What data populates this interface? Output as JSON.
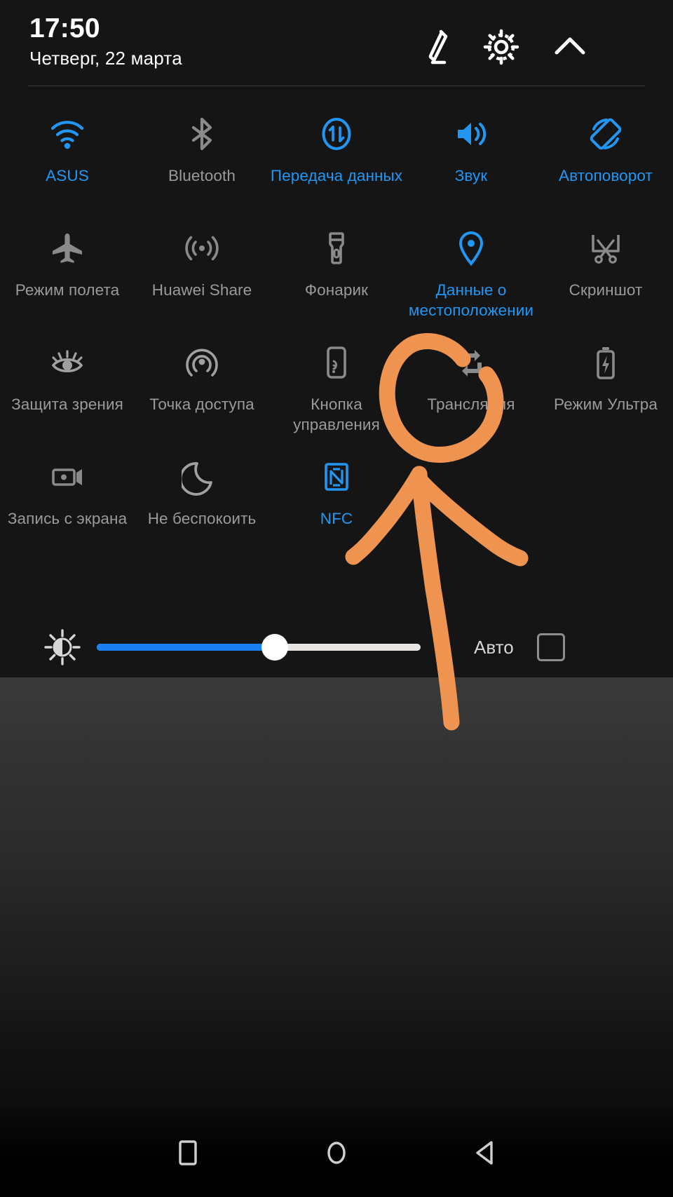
{
  "header": {
    "time": "17:50",
    "date": "Четверг, 22 марта",
    "edit_icon": "pencil-edit-icon",
    "settings_icon": "gear-icon",
    "collapse_icon": "chevron-up-icon"
  },
  "colors": {
    "active": "#2196f3",
    "inactive": "#9a9a9a",
    "shade_bg": "#151515",
    "annotation": "#ef9350",
    "slider_fill": "#1a7ff0",
    "slider_track": "#e8e6e3"
  },
  "tiles": [
    {
      "label": "ASUS",
      "icon": "wifi-icon",
      "state": "on"
    },
    {
      "label": "Bluetooth",
      "icon": "bluetooth-icon",
      "state": "off"
    },
    {
      "label": "Передача данных",
      "icon": "mobile-data-icon",
      "state": "on"
    },
    {
      "label": "Звук",
      "icon": "volume-icon",
      "state": "on"
    },
    {
      "label": "Автоповорот",
      "icon": "auto-rotate-icon",
      "state": "on"
    },
    {
      "label": "Режим полета",
      "icon": "airplane-icon",
      "state": "off"
    },
    {
      "label": "Huawei Share",
      "icon": "huawei-share-icon",
      "state": "off"
    },
    {
      "label": "Фонарик",
      "icon": "flashlight-icon",
      "state": "off"
    },
    {
      "label": "Данные о местоположении",
      "icon": "location-pin-icon",
      "state": "on"
    },
    {
      "label": "Скриншот",
      "icon": "screenshot-icon",
      "state": "off"
    },
    {
      "label": "Защита зрения",
      "icon": "eye-comfort-icon",
      "state": "off"
    },
    {
      "label": "Точка доступа",
      "icon": "hotspot-icon",
      "state": "off"
    },
    {
      "label": "Кнопка управления",
      "icon": "nav-dock-icon",
      "state": "off"
    },
    {
      "label": "Трансляция",
      "icon": "cast-icon",
      "state": "off"
    },
    {
      "label": "Режим Ультра",
      "icon": "battery-ultra-icon",
      "state": "off"
    },
    {
      "label": "Запись с экрана",
      "icon": "screen-record-icon",
      "state": "off"
    },
    {
      "label": "Не беспокоить",
      "icon": "moon-icon",
      "state": "off"
    },
    {
      "label": "NFC",
      "icon": "nfc-icon",
      "state": "on"
    },
    {
      "label": "",
      "icon": "",
      "state": "off"
    },
    {
      "label": "",
      "icon": "",
      "state": "off"
    }
  ],
  "brightness": {
    "icon": "brightness-sun-icon",
    "value_percent": 55,
    "auto_label": "Авто",
    "auto_checked": false
  },
  "annotation": {
    "color": "#ef9350",
    "shapes": [
      "circle-highlight-trenslyaciya",
      "arrow-pointing-up"
    ],
    "target_tile_label": "Трансляция"
  },
  "navbar": {
    "recents_icon": "square-recents-icon",
    "home_icon": "circle-home-icon",
    "back_icon": "triangle-back-icon"
  }
}
